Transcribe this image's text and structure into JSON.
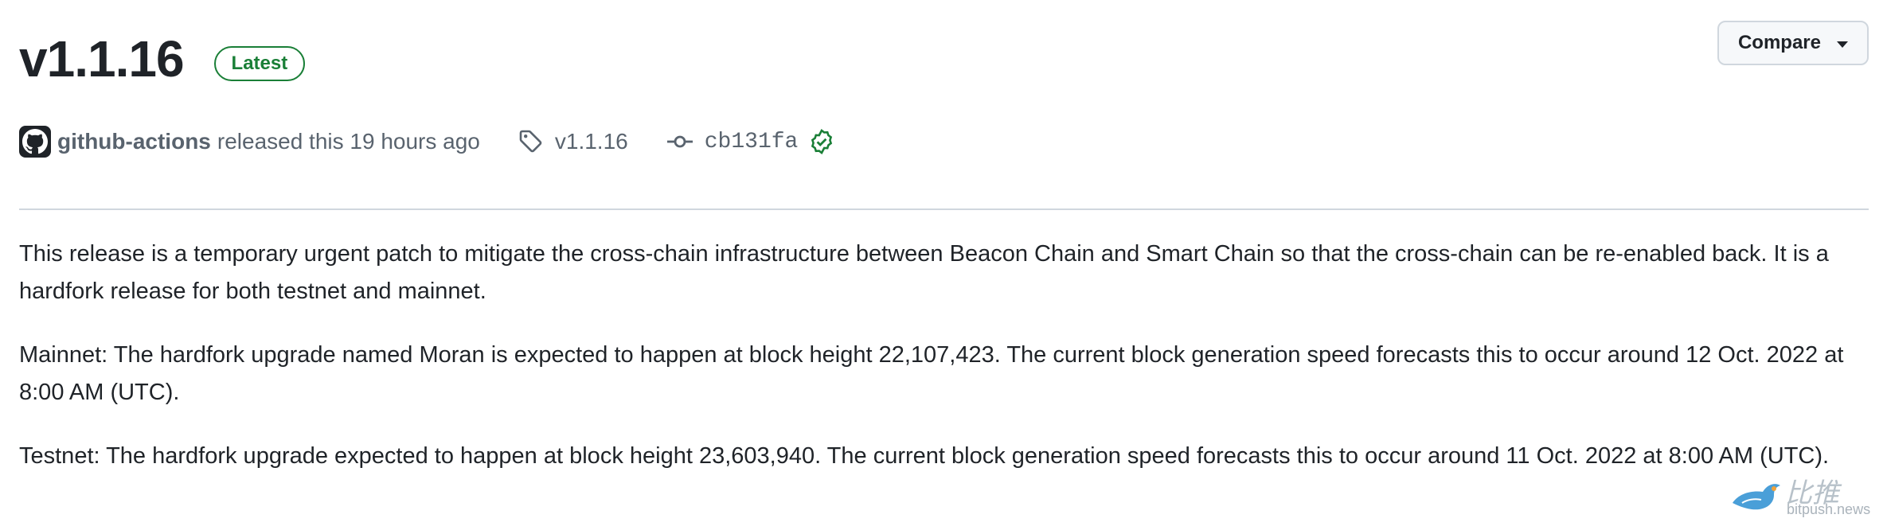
{
  "release": {
    "title": "v1.1.16",
    "badge": "Latest",
    "compare_label": "Compare"
  },
  "meta": {
    "author": "github-actions",
    "released_text": "released this 19 hours ago",
    "tag": "v1.1.16",
    "commit": "cb131fa",
    "icons": [
      "github-avatar-icon",
      "tag-icon",
      "git-commit-icon",
      "verified-check-icon",
      "caret-down-icon"
    ]
  },
  "notes": {
    "paragraphs": [
      "This release is a temporary urgent patch to mitigate the cross-chain infrastructure between Beacon Chain and Smart Chain so that the cross-chain can be re-enabled back. It is a hardfork release for both testnet and mainnet.",
      "Mainnet: The hardfork upgrade named Moran is expected to happen at block height 22,107,423. The current block generation speed forecasts this to occur around 12 Oct. 2022 at 8:00 AM (UTC).",
      "Testnet: The hardfork upgrade expected to happen at block height 23,603,940. The current block generation speed forecasts this to occur around 11 Oct. 2022 at 8:00 AM (UTC)."
    ]
  },
  "watermark": {
    "name": "比推",
    "url": "bitpush.news"
  },
  "colors": {
    "text": "#1f2328",
    "muted": "#59636e",
    "success": "#1a7f37",
    "border": "#d0d7de"
  }
}
